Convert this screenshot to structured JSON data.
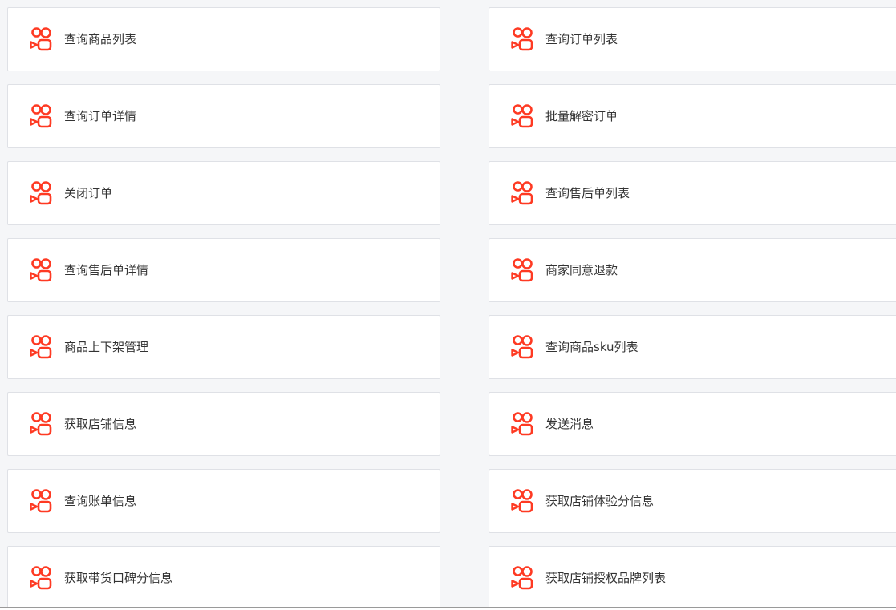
{
  "brand": {
    "icon_name": "kuaishou-logo-icon",
    "accent_color": "#fe3a23"
  },
  "cards": [
    {
      "id": "query-product-list",
      "label": "查询商品列表"
    },
    {
      "id": "query-order-list",
      "label": "查询订单列表"
    },
    {
      "id": "query-order-detail",
      "label": "查询订单详情"
    },
    {
      "id": "batch-decrypt-orders",
      "label": "批量解密订单"
    },
    {
      "id": "close-order",
      "label": "关闭订单"
    },
    {
      "id": "query-aftersale-list",
      "label": "查询售后单列表"
    },
    {
      "id": "query-aftersale-detail",
      "label": "查询售后单详情"
    },
    {
      "id": "merchant-approve-refund",
      "label": "商家同意退款"
    },
    {
      "id": "product-list-delist",
      "label": "商品上下架管理"
    },
    {
      "id": "query-product-sku-list",
      "label": "查询商品sku列表"
    },
    {
      "id": "get-shop-info",
      "label": "获取店铺信息"
    },
    {
      "id": "send-message",
      "label": "发送消息"
    },
    {
      "id": "query-bill-info",
      "label": "查询账单信息"
    },
    {
      "id": "get-shop-experience-score",
      "label": "获取店铺体验分信息"
    },
    {
      "id": "get-sales-reputation-score",
      "label": "获取带货口碑分信息"
    },
    {
      "id": "get-shop-authorized-brands",
      "label": "获取店铺授权品牌列表"
    }
  ]
}
